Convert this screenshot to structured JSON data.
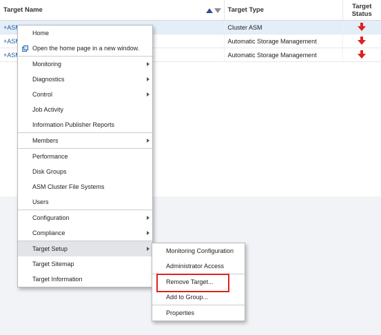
{
  "table": {
    "columns": {
      "name": "Target Name",
      "type": "Target Type",
      "status": "Target Status"
    },
    "rows": [
      {
        "name": "+ASM",
        "type": "Cluster ASM",
        "status_icon": "down-arrow-icon"
      },
      {
        "name": "+ASM",
        "type": "Automatic Storage Management",
        "status_icon": "down-arrow-icon"
      },
      {
        "name": "+ASM",
        "type": "Automatic Storage Management",
        "status_icon": "down-arrow-icon"
      }
    ],
    "status_color": "#e0201c"
  },
  "menu": {
    "home": "Home",
    "open_new_window": "Open the home page in a new window.",
    "monitoring": "Monitoring",
    "diagnostics": "Diagnostics",
    "control": "Control",
    "job_activity": "Job Activity",
    "info_publisher": "Information Publisher Reports",
    "members": "Members",
    "performance": "Performance",
    "disk_groups": "Disk Groups",
    "asm_cluster_fs": "ASM Cluster File Systems",
    "users": "Users",
    "configuration": "Configuration",
    "compliance": "Compliance",
    "target_setup": "Target Setup",
    "target_sitemap": "Target Sitemap",
    "target_information": "Target Information"
  },
  "submenu": {
    "monitoring_configuration": "Monitoring Configuration",
    "administrator_access": "Administrator Access",
    "remove_target": "Remove Target...",
    "add_to_group": "Add to Group...",
    "properties": "Properties"
  },
  "highlight_color": "#e0201c"
}
